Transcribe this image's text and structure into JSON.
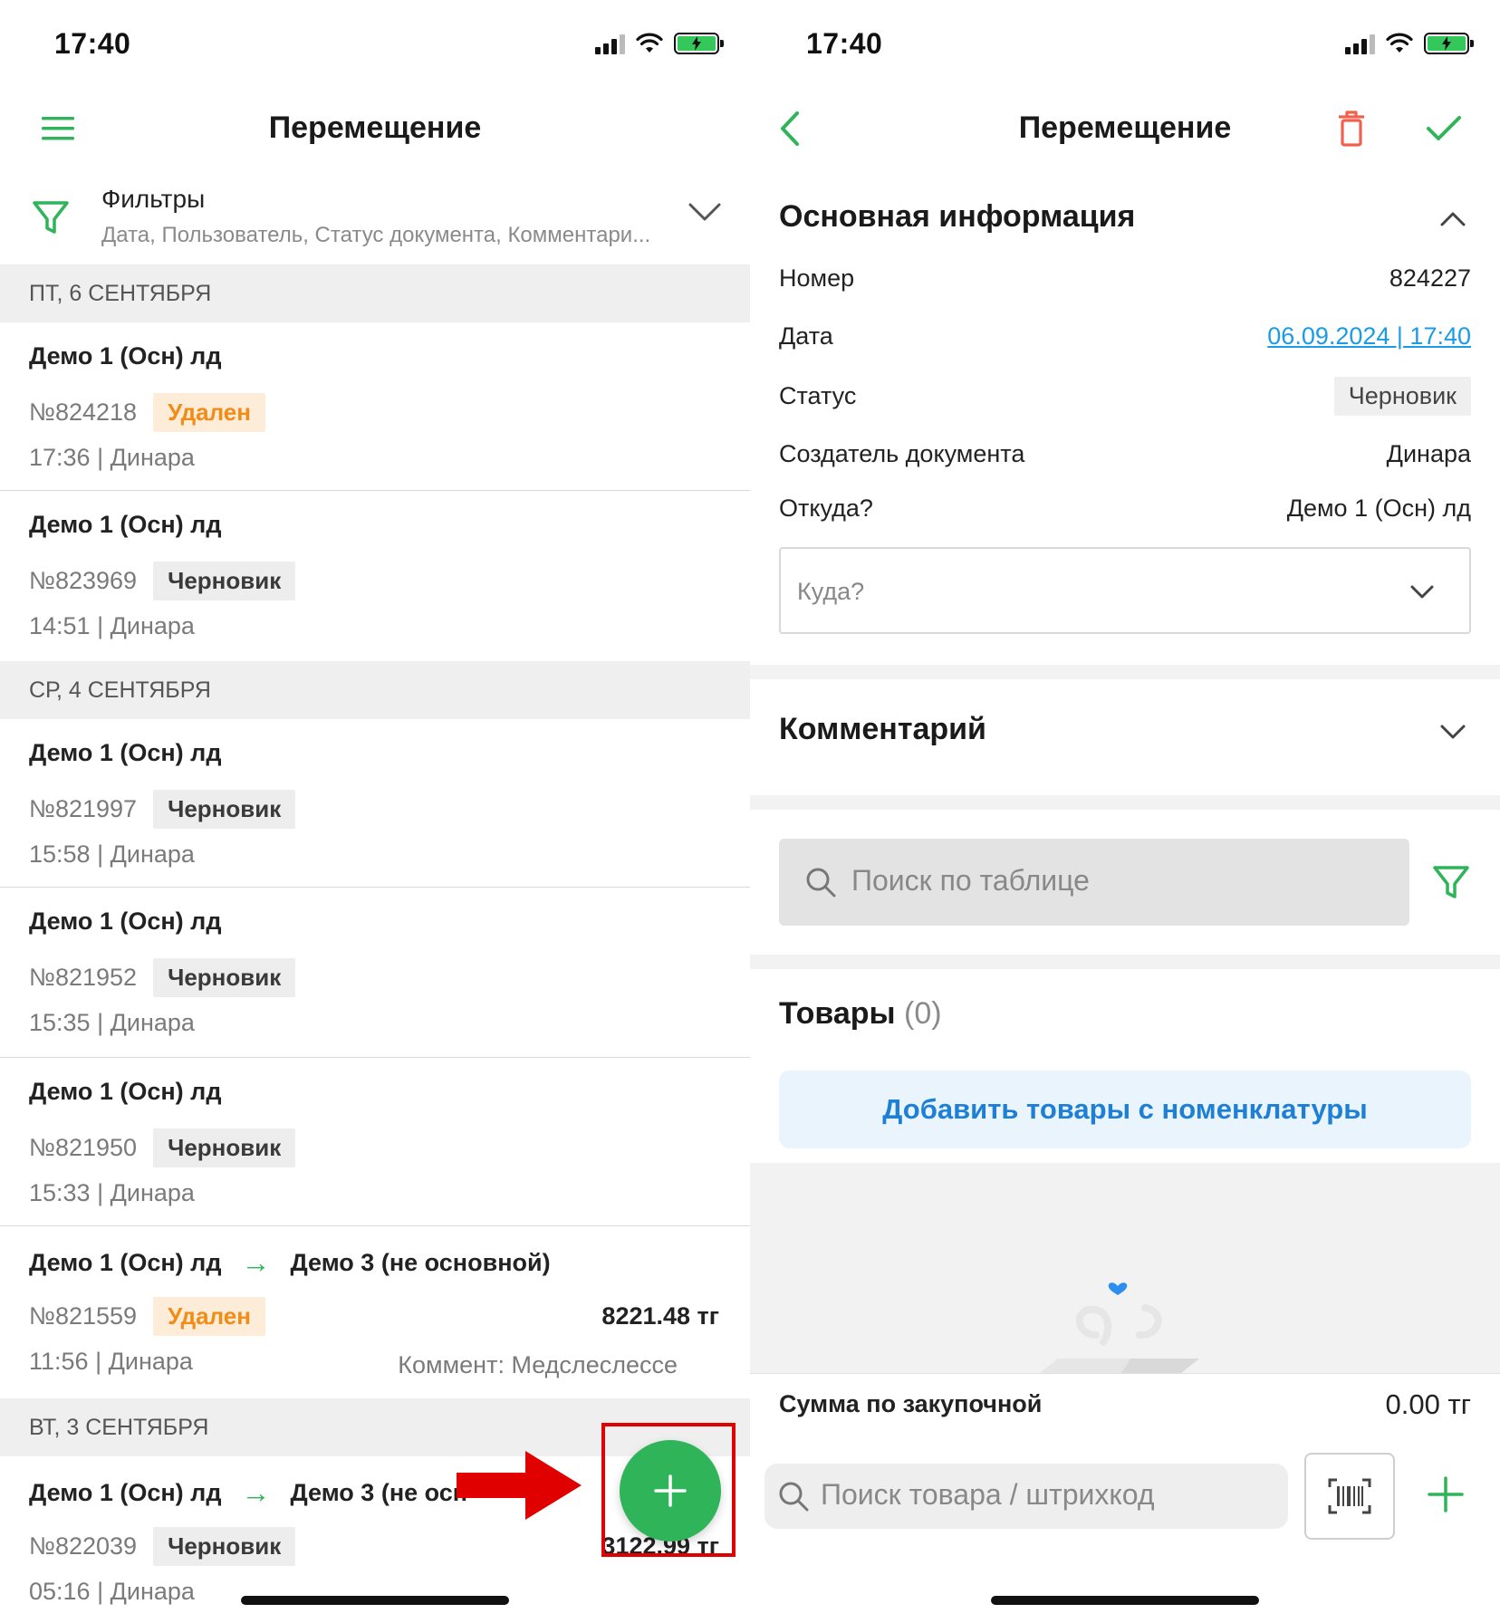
{
  "left": {
    "status_time": "17:40",
    "title": "Перемещение",
    "filter": {
      "title": "Фильтры",
      "subtitle": "Дата, Пользователь, Статус документа, Комментари..."
    },
    "groups": [
      {
        "header": "ПТ, 6 СЕНТЯБРЯ",
        "items": [
          {
            "title": "Демо 1 (Осн) лд",
            "number": "№824218",
            "status": "Удален",
            "meta": "17:36 | Динара"
          },
          {
            "title": "Демо 1 (Осн) лд",
            "number": "№823969",
            "status": "Черновик",
            "meta": "14:51 | Динара"
          }
        ]
      },
      {
        "header": "СР, 4 СЕНТЯБРЯ",
        "items": [
          {
            "title": "Демо 1 (Осн) лд",
            "number": "№821997",
            "status": "Черновик",
            "meta": "15:58 | Динара"
          },
          {
            "title": "Демо 1 (Осн) лд",
            "number": "№821952",
            "status": "Черновик",
            "meta": "15:35 | Динара"
          },
          {
            "title": "Демо 1 (Осн) лд",
            "number": "№821950",
            "status": "Черновик",
            "meta": "15:33 | Динара"
          },
          {
            "title": "Демо 1 (Осн) лд",
            "arrow": "→",
            "destination": "Демо 3 (не основной)",
            "number": "№821559",
            "status": "Удален",
            "amount": "8221.48 тг",
            "meta": "11:56 | Динара",
            "comment": "Коммент: Медслеслессе"
          }
        ]
      },
      {
        "header": "ВТ, 3 СЕНТЯБРЯ",
        "items": [
          {
            "title": "Демо 1 (Осн) лд",
            "arrow": "→",
            "destination": "Демо 3 (не осн",
            "number": "№822039",
            "status": "Черновик",
            "amount": "3122.99 тг",
            "meta": "05:16 | Динара"
          }
        ]
      }
    ]
  },
  "right": {
    "status_time": "17:40",
    "title": "Перемещение",
    "main_info": {
      "title": "Основная информация",
      "rows": [
        {
          "label": "Номер",
          "value": "824227"
        },
        {
          "label": "Дата",
          "value": "06.09.2024 | 17:40"
        },
        {
          "label": "Статус",
          "value": "Черновик"
        },
        {
          "label": "Создатель документа",
          "value": "Динара"
        },
        {
          "label": "Откуда?",
          "value": "Демо 1 (Осн) лд"
        }
      ],
      "destination_placeholder": "Куда?"
    },
    "comment_title": "Комментарий",
    "table_search_placeholder": "Поиск по таблице",
    "goods": {
      "title": "Товары",
      "count": "(0)",
      "add_button": "Добавить товары с номенклатуры"
    },
    "sum": {
      "label": "Сумма по закупочной",
      "value": "0.00 тг"
    },
    "bottom_search_placeholder": "Поиск товара / штрихкод"
  },
  "colors": {
    "accent_green": "#2fb45a",
    "deleted_badge_text": "#f08c17",
    "link_blue": "#1a9be6",
    "delete_icon_red": "#f0604d",
    "highlight_red": "#e00000"
  },
  "icons": [
    "menu-icon",
    "filter-icon",
    "chevron-down-icon",
    "back-icon",
    "trash-icon",
    "check-icon",
    "chevron-up-icon",
    "search-icon",
    "barcode-icon",
    "plus-icon"
  ]
}
